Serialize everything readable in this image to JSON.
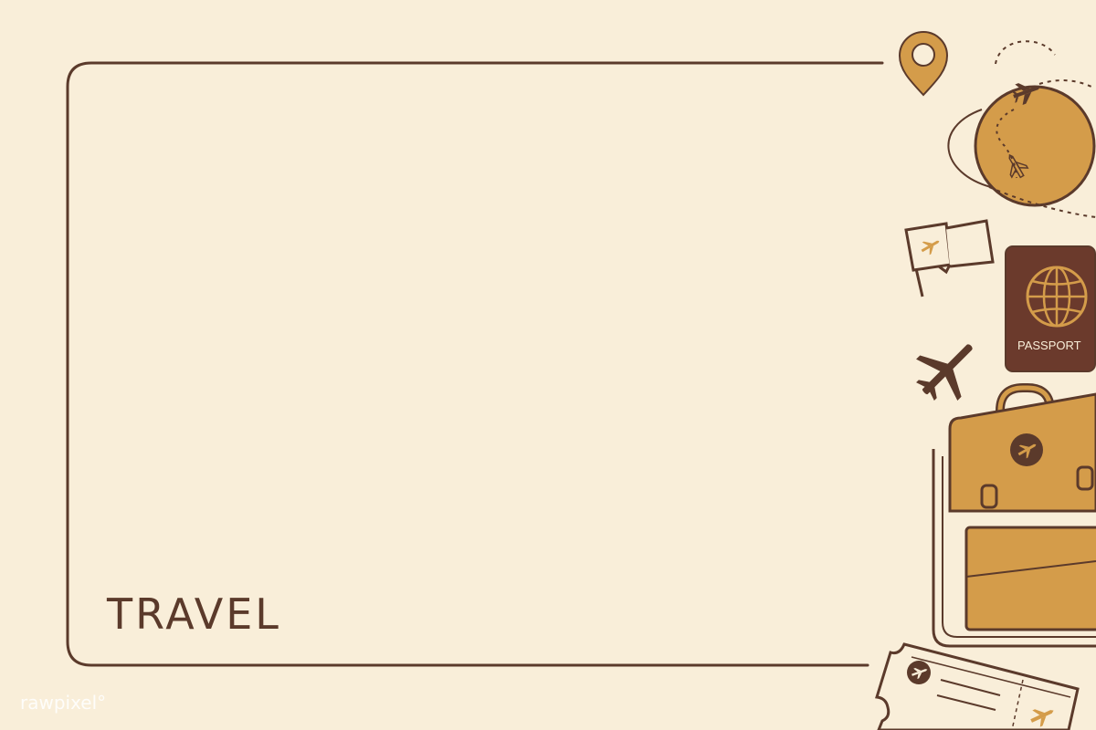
{
  "title": "TRAVEL",
  "passport_label": "PASSPORT",
  "watermark": "rawpixel°",
  "colors": {
    "background": "#f9eed9",
    "line": "#5b3a2b",
    "gold": "#d49c4a",
    "passport": "#6b3a2c"
  },
  "icons": [
    "location-pin-icon",
    "globe-icon",
    "airplane-icon",
    "flag-icon",
    "passport-icon",
    "suitcase-icon",
    "ticket-icon"
  ]
}
